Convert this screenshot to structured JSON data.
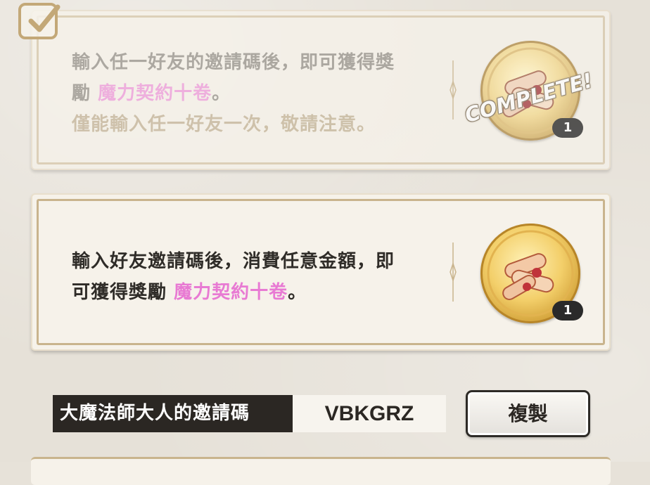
{
  "rewards": [
    {
      "line1": "輸入任一好友的邀請碼後，即可獲得獎",
      "line2_prefix": "勵 ",
      "reward_name": "魔力契約十卷",
      "line2_suffix": "。",
      "note": "僅能輸入任一好友一次，敬請注意。",
      "status": "COMPLETE!",
      "count": "1"
    },
    {
      "line1": "輸入好友邀請碼後，消費任意金額，即",
      "line2_prefix": "可獲得獎勵 ",
      "reward_name": "魔力契約十卷",
      "line2_suffix": "。",
      "count": "1"
    }
  ],
  "invite": {
    "label": "大魔法師大人的邀請碼",
    "code": "VBKGRZ",
    "copy_label": "複製"
  },
  "colors": {
    "accent_pink": "#e87ad3",
    "frame_gold": "#c9b48d",
    "dark": "#2b2723"
  }
}
